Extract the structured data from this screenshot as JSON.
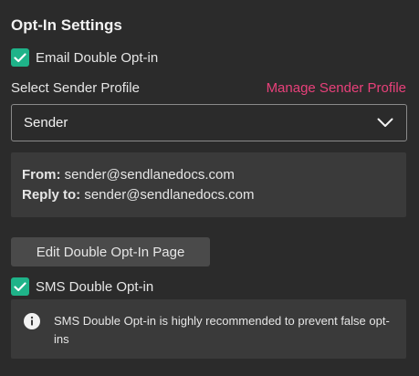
{
  "section": {
    "title": "Opt-In Settings"
  },
  "email_double_optin": {
    "label": "Email Double Opt-in",
    "checked": true
  },
  "sender": {
    "select_label": "Select Sender Profile",
    "manage_link": "Manage Sender Profile",
    "selected_value": "Sender",
    "from_key": "From:",
    "from_value": "sender@sendlanedocs.com",
    "reply_key": "Reply to:",
    "reply_value": "sender@sendlanedocs.com"
  },
  "edit_button": {
    "label": "Edit Double Opt-In Page"
  },
  "sms_double_optin": {
    "label": "SMS Double Opt-in",
    "checked": true
  },
  "notice": {
    "text": "SMS Double Opt-in is highly recommended to prevent false opt-ins",
    "icon": "info-icon"
  },
  "colors": {
    "background": "#2b2b2b",
    "checkbox": "#1fb389",
    "link": "#e8407a",
    "panel": "#3a3a3a",
    "button": "#4a4a4a"
  }
}
